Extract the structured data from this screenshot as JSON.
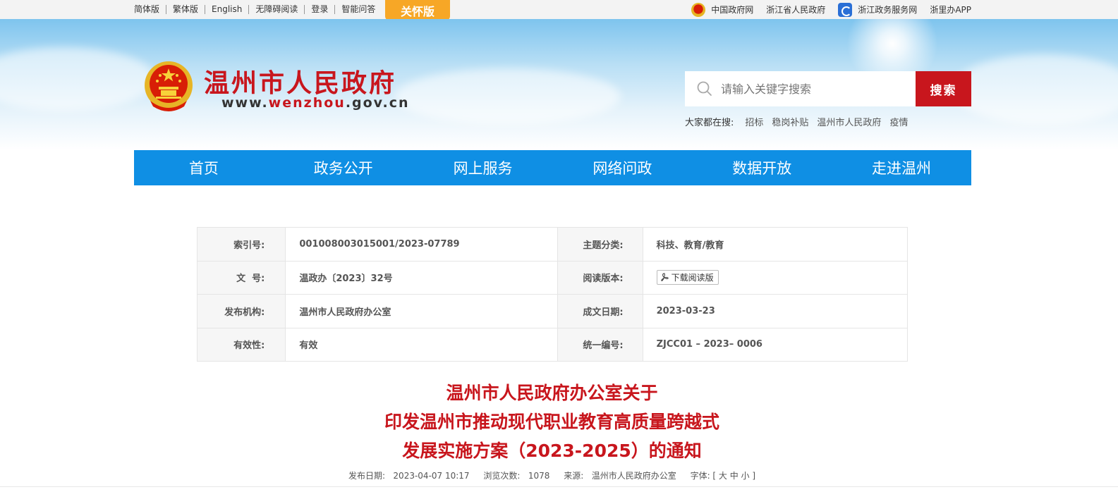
{
  "topbar": {
    "links": [
      "简体版",
      "繁体版",
      "English",
      "无障碍阅读",
      "登录",
      "智能问答"
    ],
    "care_label": "关怀版",
    "right_links": [
      "中国政府网",
      "浙江省人民政府",
      "浙江政务服务网",
      "浙里办APP"
    ]
  },
  "header": {
    "site_name": "温州市人民政府",
    "domain_prefix": "www.",
    "domain_highlight": "wenzhou",
    "domain_suffix": ".gov.cn"
  },
  "search": {
    "placeholder": "请输入关键字搜索",
    "button_label": "搜索",
    "hot_label": "大家都在搜:",
    "hot_words": [
      "招标",
      "稳岗补贴",
      "温州市人民政府",
      "疫情"
    ]
  },
  "nav": {
    "items": [
      "首页",
      "政务公开",
      "网上服务",
      "网络问政",
      "数据开放",
      "走进温州"
    ]
  },
  "info": {
    "index_label": "索引号:",
    "index_value": "001008003015001/2023-07789",
    "topic_label": "主题分类:",
    "topic_value": "科技、教育/教育",
    "doc_no_label": "文  号:",
    "doc_no_value": "温政办〔2023〕32号",
    "read_label": "阅读版本:",
    "read_button": "下载阅读版",
    "org_label": "发布机构:",
    "org_value": "温州市人民政府办公室",
    "date_label": "成文日期:",
    "date_value": "2023-03-23",
    "validity_label": "有效性:",
    "validity_value": "有效",
    "code_label": "统一编号:",
    "code_value": "ZJCC01 – 2023– 0006"
  },
  "article": {
    "title_line1": "温州市人民政府办公室关于",
    "title_line2": "印发温州市推动现代职业教育高质量跨越式",
    "title_line3": "发展实施方案（2023-2025）的通知",
    "publish_date": "发布日期:   2023-04-07 10:17",
    "views": "浏览次数:   1078",
    "source": "来源:   温州市人民政府办公室",
    "font_size": "字体: [ 大 中 小 ]"
  }
}
